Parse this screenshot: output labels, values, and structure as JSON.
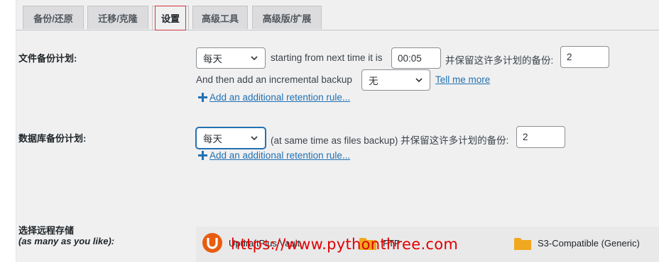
{
  "tabs": [
    {
      "label": "备份/还原"
    },
    {
      "label": "迁移/克隆"
    },
    {
      "label": "设置"
    },
    {
      "label": "高级工具"
    },
    {
      "label": "高级版/扩展"
    }
  ],
  "files_schedule": {
    "label": "文件备份计划:",
    "interval_value": "每天",
    "starting_text": "starting from next time it is",
    "time_value": "00:05",
    "retain_text": "并保留这许多计划的备份:",
    "retain_value": "2",
    "incremental_text": "And then add an incremental backup",
    "incremental_value": "无",
    "tell_me_more": "Tell me more",
    "add_retention": "Add an additional retention rule..."
  },
  "db_schedule": {
    "label": "数据库备份计划:",
    "interval_value": "每天",
    "same_time_text": "(at same time as files backup) 并保留这许多计划的备份:",
    "retain_value": "2",
    "add_retention": "Add an additional retention rule..."
  },
  "remote": {
    "label": "选择远程存储",
    "sublabel": "(as many as you like):",
    "items": [
      {
        "name": "UpdraftPlus Vault",
        "icon": "updraftplus-logo"
      },
      {
        "name": "FTP",
        "icon": "folder-icon"
      },
      {
        "name": "S3-Compatible (Generic)",
        "icon": "folder-icon"
      }
    ]
  },
  "watermark": "https://www.pythonthree.com",
  "colors": {
    "link": "#2271b1",
    "active_tab_outline": "#d63638",
    "folder": "#f0a81e",
    "updraft_orange": "#e85d0f",
    "watermark": "#e00000"
  }
}
